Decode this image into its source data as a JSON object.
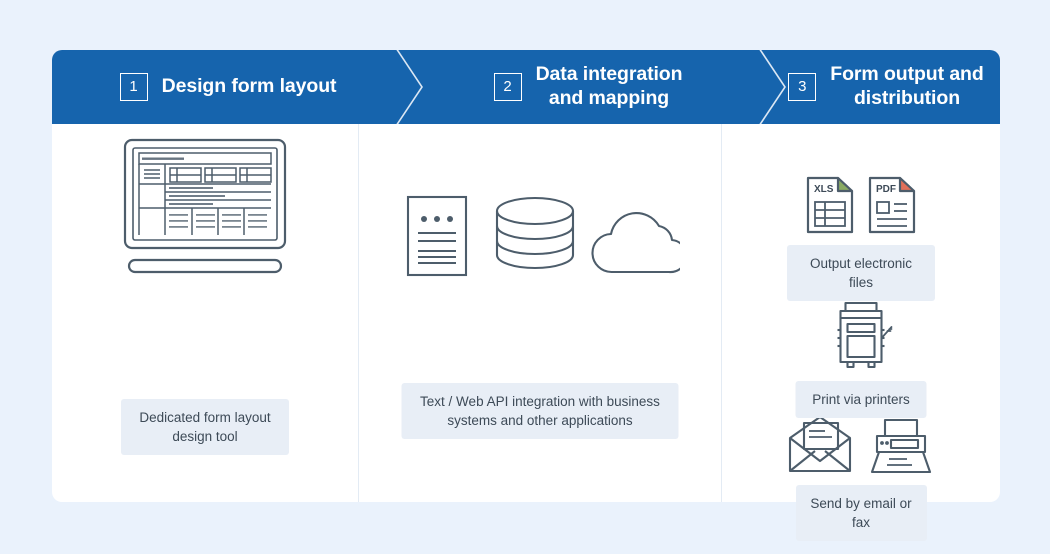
{
  "theme": {
    "page_background": "#eaf2fc",
    "card_background": "#ffffff",
    "header_blue": "#1664ad",
    "chip_background": "#e8eef6",
    "chip_text": "#3d4a57",
    "line_color": "#4d5d6b",
    "xls_corner": "#8aab63",
    "pdf_corner": "#e2705a"
  },
  "steps": [
    {
      "number": "1",
      "title": "Design form layout",
      "caption": "Dedicated form layout\ndesign tool",
      "icons": [
        "laptop-form-designer-icon"
      ]
    },
    {
      "number": "2",
      "title": "Data integration\nand mapping",
      "caption": "Text / Web API integration with business\nsystems and other applications",
      "icons": [
        "text-document-icon",
        "database-icon",
        "cloud-icon"
      ]
    },
    {
      "number": "3",
      "title": "Form output and\ndistribution",
      "groups": [
        {
          "caption": "Output electronic files",
          "icons": [
            "xls-file-icon",
            "pdf-file-icon"
          ],
          "labels": [
            "XLS",
            "PDF"
          ]
        },
        {
          "caption": "Print via printers",
          "icons": [
            "multifunction-printer-icon"
          ]
        },
        {
          "caption": "Send by email or fax",
          "icons": [
            "envelope-mail-icon",
            "fax-machine-icon"
          ]
        }
      ]
    }
  ]
}
